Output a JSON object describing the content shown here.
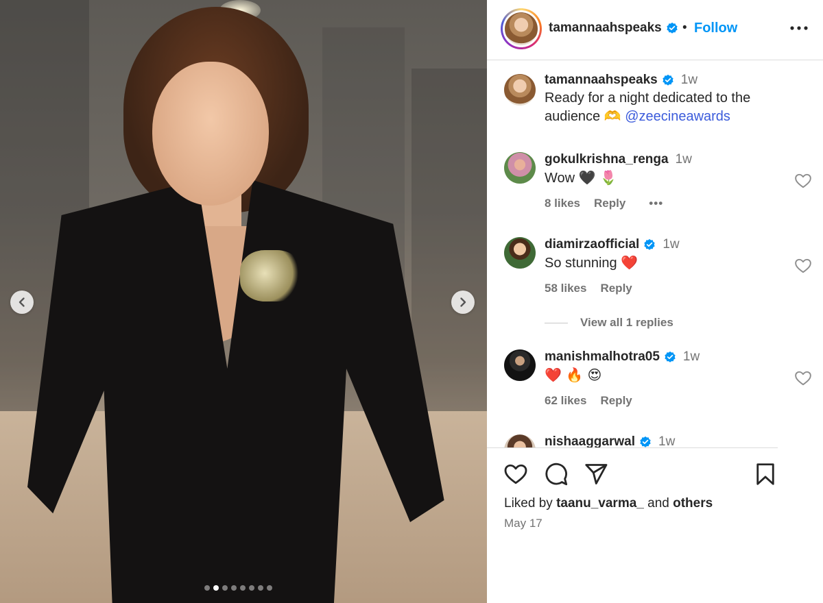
{
  "post": {
    "author": "tamannaahspeaks",
    "separator": "•",
    "follow_label": "Follow",
    "caption_time": "1w",
    "caption_text": "Ready for a night dedicated to the audience",
    "caption_emoji": "🫶",
    "caption_mention": "@zeecineawards",
    "liked_by_prefix": "Liked by",
    "liked_by_user": "taanu_varma_",
    "liked_by_and": "and",
    "liked_by_others": "others",
    "date": "May 17"
  },
  "carousel": {
    "slide_count": 8,
    "active_slide": 2
  },
  "comments": [
    {
      "user": "gokulkrishna_renga",
      "verified": false,
      "time": "1w",
      "text": "Wow",
      "emoji": "🖤 🌷",
      "likes": "8 likes",
      "reply": "Reply",
      "more": "•••"
    },
    {
      "user": "diamirzaofficial",
      "verified": true,
      "time": "1w",
      "text": "So stunning",
      "emoji": "❤️",
      "likes": "58 likes",
      "reply": "Reply"
    },
    {
      "user": "manishmalhotra05",
      "verified": true,
      "time": "1w",
      "text": "",
      "emoji": "❤️ 🔥 😍",
      "likes": "62 likes",
      "reply": "Reply"
    },
    {
      "user": "nishaaggarwal",
      "verified": true,
      "time": "1w"
    }
  ],
  "view_replies_label": "View all 1 replies",
  "icons": {
    "more": "more-horizontal-icon",
    "verified": "verified-badge-icon",
    "like": "heart-icon",
    "comment": "comment-icon",
    "share": "share-icon",
    "save": "bookmark-icon",
    "prev": "chevron-left-icon",
    "next": "chevron-right-icon"
  },
  "colors": {
    "accent": "#0095f6",
    "verified": "#0095f6",
    "text": "#262626",
    "muted": "#737373",
    "heart_red": "#ed4956"
  }
}
